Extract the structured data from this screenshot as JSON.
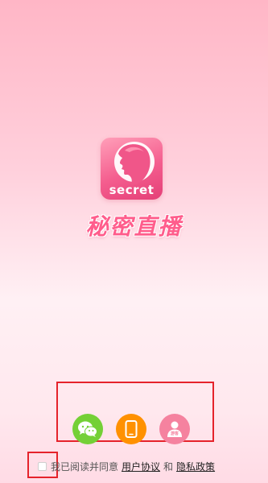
{
  "app": {
    "icon_text": "secret",
    "name": "秘密直播"
  },
  "login_options": [
    {
      "name": "wechat",
      "icon": "wechat-icon",
      "color": "#74d036"
    },
    {
      "name": "phone",
      "icon": "phone-icon",
      "color": "#ff9100"
    },
    {
      "name": "guest",
      "icon": "guest-icon",
      "color": "#f5829f",
      "icon_text": "游客"
    }
  ],
  "agreement": {
    "checked": false,
    "prefix": "我已阅读并同意",
    "user_agreement": "用户协议",
    "conjunction": "和",
    "privacy_policy": "隐私政策"
  },
  "colors": {
    "highlight": "#e5232b",
    "brand_pink": "#ff5d8c"
  }
}
